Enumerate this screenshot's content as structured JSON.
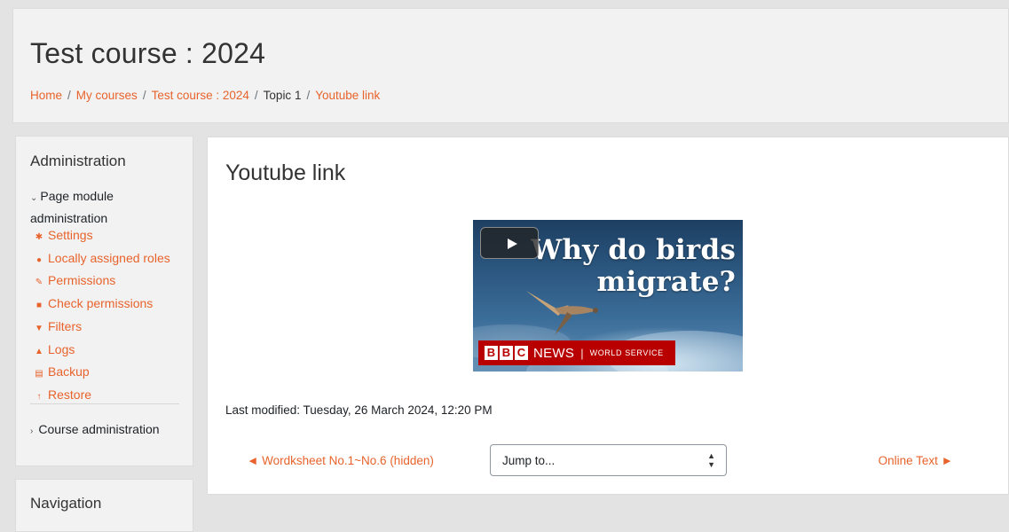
{
  "header": {
    "course_title": "Test course : 2024",
    "breadcrumb": [
      {
        "label": "Home",
        "link": true
      },
      {
        "label": "My courses",
        "link": true
      },
      {
        "label": "Test course : 2024",
        "link": true
      },
      {
        "label": "Topic 1",
        "link": false
      },
      {
        "label": "Youtube link",
        "link": true
      }
    ]
  },
  "admin_block": {
    "title": "Administration",
    "page_module_admin": "Page module administration",
    "items": [
      {
        "label": "Settings",
        "icon": "gear-icon"
      },
      {
        "label": "Locally assigned roles",
        "icon": "user-icon"
      },
      {
        "label": "Permissions",
        "icon": "pencil-square-icon"
      },
      {
        "label": "Check permissions",
        "icon": "lock-icon"
      },
      {
        "label": "Filters",
        "icon": "filter-icon"
      },
      {
        "label": "Logs",
        "icon": "chart-icon"
      },
      {
        "label": "Backup",
        "icon": "file-icon"
      },
      {
        "label": "Restore",
        "icon": "upload-icon"
      }
    ],
    "course_admin": "Course administration"
  },
  "nav_block": {
    "title": "Navigation"
  },
  "main": {
    "title": "Youtube link",
    "video": {
      "headline_line1": "Why do birds",
      "headline_line2": "migrate?",
      "brand_b1": "B",
      "brand_b2": "B",
      "brand_c": "C",
      "brand_news": "NEWS",
      "brand_sep": "|",
      "brand_service": "WORLD SERVICE"
    },
    "last_modified": "Last modified: Tuesday, 26 March 2024, 12:20 PM",
    "nav": {
      "prev_label": "◄ Wordksheet No.1~No.6 (hidden)",
      "jump_value": "Jump to...",
      "next_label": "Online Text ►"
    }
  },
  "colors": {
    "link": "#e8632c",
    "bbc_red": "#b80000",
    "page_bg": "#e3e3e3"
  }
}
